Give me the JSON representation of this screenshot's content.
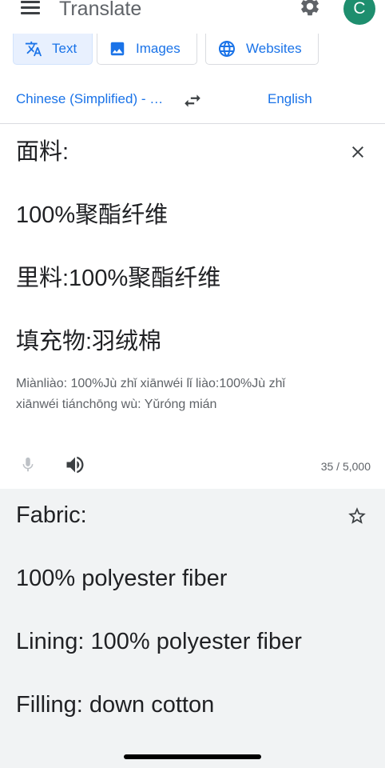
{
  "header": {
    "title": "Translate",
    "avatar_letter": "C"
  },
  "tabs": [
    {
      "label": "Text",
      "icon": "translate-icon",
      "active": true
    },
    {
      "label": "Images",
      "icon": "image-icon",
      "active": false
    },
    {
      "label": "Websites",
      "icon": "globe-icon",
      "active": false
    }
  ],
  "languages": {
    "source": "Chinese (Simplified) - …",
    "target": "English"
  },
  "source": {
    "lines": [
      "面料:",
      "100%聚酯纤维",
      "里料:100%聚酯纤维",
      "填充物:羽绒棉"
    ],
    "romanization": "Miànliào: 100%Jù zhǐ xiānwéi lǐ liào:100%Jù zhǐ xiānwéi tiánchōng wù: Yǔróng mián",
    "char_count": "35 / 5,000"
  },
  "translation": {
    "lines": [
      "Fabric:",
      "100% polyester fiber",
      "Lining: 100% polyester fiber",
      "Filling: down cotton"
    ]
  },
  "colors": {
    "accent": "#1a73e8",
    "avatar": "#1e8e6e",
    "result_bg": "#f1f3f4"
  }
}
